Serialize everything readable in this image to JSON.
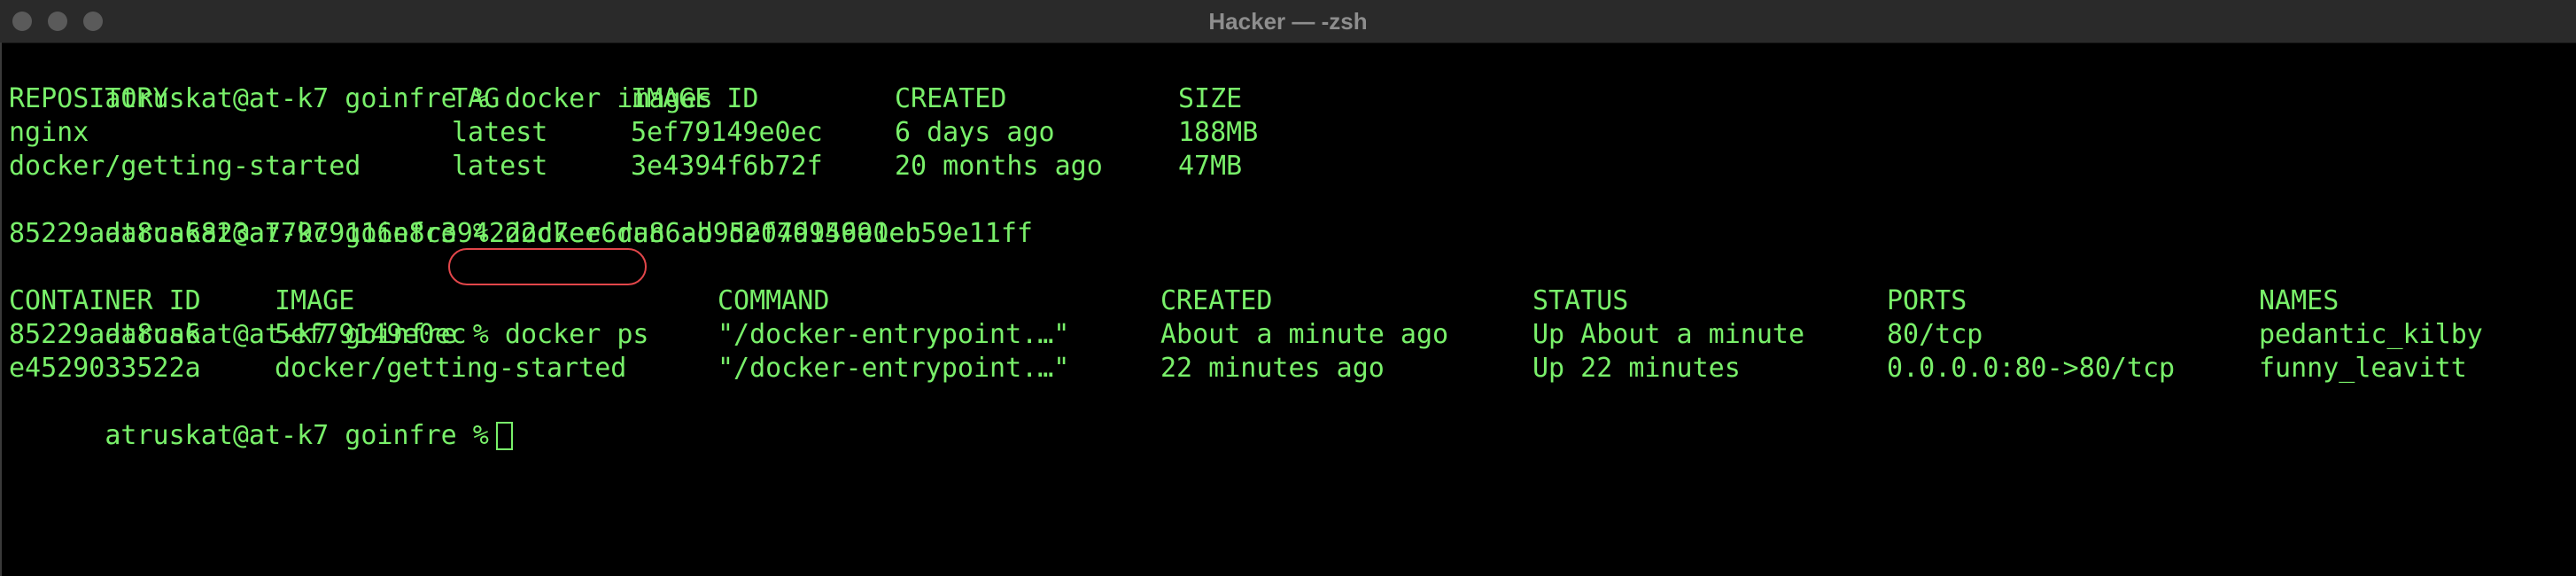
{
  "window": {
    "title": "Hacker — -zsh"
  },
  "terminal": {
    "colors": {
      "background": "#000000",
      "foreground": "#79f06a",
      "annotation": "#e2464a",
      "titlebar": "#2a2a2a"
    },
    "prompt": "atruskat@at-k7 goinfre %",
    "commands": {
      "images": "docker images",
      "run": "docker run -d 5ef79149e0ec",
      "ps": "docker ps"
    },
    "run_output": "85229ada8ca6823a779c9116e8c394222d7ee6da86ab9d204d95691eb59e11ff",
    "images_table": {
      "headers": [
        "REPOSITORY",
        "TAG",
        "IMAGE ID",
        "CREATED",
        "SIZE"
      ],
      "rows": [
        [
          "nginx",
          "latest",
          "5ef79149e0ec",
          "6 days ago",
          "188MB"
        ],
        [
          "docker/getting-started",
          "latest",
          "3e4394f6b72f",
          "20 months ago",
          "47MB"
        ]
      ]
    },
    "ps_table": {
      "headers": [
        "CONTAINER ID",
        "IMAGE",
        "COMMAND",
        "CREATED",
        "STATUS",
        "PORTS",
        "NAMES"
      ],
      "rows": [
        [
          "85229ada8ca6",
          "5ef79149e0ec",
          "\"/docker-entrypoint.…\"",
          "About a minute ago",
          "Up About a minute",
          "80/tcp",
          "pedantic_kilby"
        ],
        [
          "e4529033522a",
          "docker/getting-started",
          "\"/docker-entrypoint.…\"",
          "22 minutes ago",
          "Up 22 minutes",
          "0.0.0.0:80->80/tcp",
          "funny_leavitt"
        ]
      ]
    },
    "highlighted_command": "docker ps"
  }
}
